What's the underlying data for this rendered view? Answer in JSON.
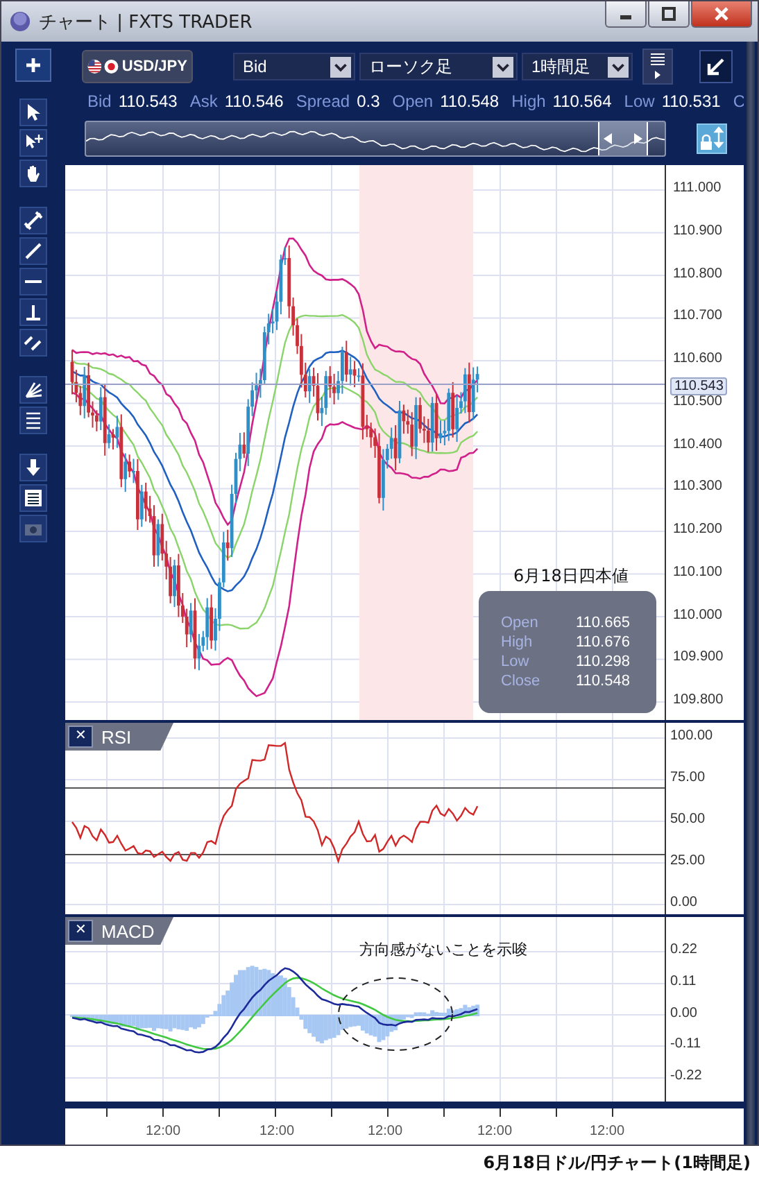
{
  "window": {
    "title": "チャート | FXTS TRADER"
  },
  "toolbar": {
    "symbol": "USD/JPY",
    "price_type": "Bid",
    "chart_type": "ローソク足",
    "timeframe": "1時間足"
  },
  "quote": [
    {
      "label": "Bid",
      "value": "110.543"
    },
    {
      "label": "Ask",
      "value": "110.546"
    },
    {
      "label": "Spread",
      "value": "0.3"
    },
    {
      "label": "Open",
      "value": "110.548"
    },
    {
      "label": "High",
      "value": "110.564"
    },
    {
      "label": "Low",
      "value": "110.531"
    },
    {
      "label": "C"
    }
  ],
  "price_axis": {
    "ticks": [
      "111.000",
      "110.900",
      "110.800",
      "110.700",
      "110.600",
      "110.500",
      "110.400",
      "110.300",
      "110.200",
      "110.100",
      "110.000",
      "109.900",
      "109.800"
    ],
    "current": "110.543"
  },
  "ohlc_box": {
    "title": "6月18日四本値",
    "rows": [
      {
        "label": "Open",
        "value": "110.665"
      },
      {
        "label": "High",
        "value": "110.676"
      },
      {
        "label": "Low",
        "value": "110.298"
      },
      {
        "label": "Close",
        "value": "110.548"
      }
    ]
  },
  "rsi_panel": {
    "close": "✕",
    "title": "RSI",
    "ticks": [
      "100.00",
      "75.00",
      "50.00",
      "25.00",
      "0.00"
    ]
  },
  "macd_panel": {
    "close": "✕",
    "title": "MACD",
    "note": "方向感がないことを示唆",
    "ticks": [
      "0.22",
      "0.11",
      "0.00",
      "-0.11",
      "-0.22"
    ]
  },
  "time_axis": {
    "labels": [
      "12:00",
      "12:00",
      "12:00",
      "12:00",
      "12:00"
    ]
  },
  "caption": "6月18日ドル/円チャート(1時間足)"
}
